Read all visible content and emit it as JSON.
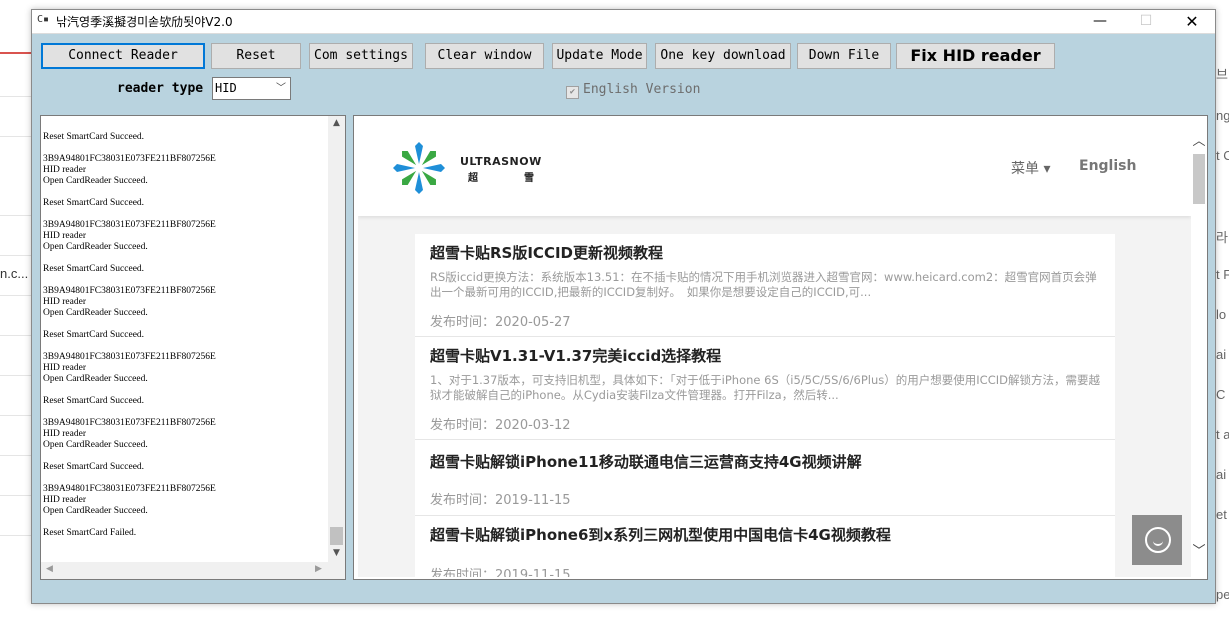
{
  "window": {
    "title": "낚汽영季溪擬경미솓欤劤됫야V2.0",
    "icon_text": "C▪",
    "controls": {
      "minimize": "—",
      "maximize": "☐",
      "close": "✕"
    }
  },
  "toolbar": {
    "connect": "Connect Reader",
    "reset": "Reset",
    "com_settings": "Com settings",
    "clear_window": "Clear window",
    "update_mode": "Update Mode",
    "one_key_download": "One key download",
    "down_file": "Down File",
    "fix_hid": "Fix HID reader"
  },
  "reader_type": {
    "label": "reader type",
    "value": "HID"
  },
  "english_version": {
    "label": "English Version",
    "checked": true
  },
  "log_lines": [
    "Reset SmartCard Succeed.",
    "",
    "3B9A94801FC38031E073FE211BF807256E",
    "HID reader",
    "Open CardReader Succeed.",
    "",
    "Reset SmartCard Succeed.",
    "",
    "3B9A94801FC38031E073FE211BF807256E",
    "HID reader",
    "Open CardReader Succeed.",
    "",
    "Reset SmartCard Succeed.",
    "",
    "3B9A94801FC38031E073FE211BF807256E",
    "HID reader",
    "Open CardReader Succeed.",
    "",
    "Reset SmartCard Succeed.",
    "",
    "3B9A94801FC38031E073FE211BF807256E",
    "HID reader",
    "Open CardReader Succeed.",
    "",
    "Reset SmartCard Succeed.",
    "",
    "3B9A94801FC38031E073FE211BF807256E",
    "HID reader",
    "Open CardReader Succeed.",
    "",
    "Reset SmartCard Succeed.",
    "",
    "3B9A94801FC38031E073FE211BF807256E",
    "HID reader",
    "Open CardReader Succeed.",
    "",
    "Reset SmartCard Failed."
  ],
  "web": {
    "logo_text": "ULTRASNOW",
    "logo_cn": "超雪",
    "menu": "菜单 ▾",
    "lang": "English",
    "articles": [
      {
        "title": "超雪卡贴RS版ICCID更新视频教程",
        "summary": "RS版iccid更换方法：系统版本13.51：在不插卡贴的情况下用手机浏览器进入超雪官网：www.heicard.com2：超雪官网首页会弹出一个最新可用的ICCID,把最新的ICCID复制好。　如果你是想要设定自己的ICCID,可...",
        "date": "发布时间：2020-05-27"
      },
      {
        "title": "超雪卡贴V1.31-V1.37完美iccid选择教程",
        "summary": "1、对于1.37版本，可支持旧机型，具体如下：「对于低于iPhone 6S（i5/5C/5S/6/6Plus）的用户想要使用ICCID解锁方法，需要越狱才能破解自己的iPhone。从Cydia安装Filza文件管理器。打开Filza，然后转...",
        "date": "发布时间：2020-03-12"
      },
      {
        "title": "超雪卡贴解锁iPhone11移动联通电信三运营商支持4G视频讲解",
        "summary": "",
        "date": "发布时间：2019-11-15"
      },
      {
        "title": "超雪卡贴解锁iPhone6到x系列三网机型使用中国电信卡4G视频教程",
        "summary": "",
        "date": "发布时间：2019-11-15"
      }
    ]
  },
  "background": {
    "left_text": "n.c...",
    "right_items": [
      "브",
      "ng",
      "t C",
      "라",
      "t F",
      "lo",
      "ai",
      "C",
      "t a",
      "ai",
      "et",
      "pe"
    ]
  },
  "colors": {
    "window_bg": "#b9d3df",
    "button_bg": "#e1e1e1",
    "focus_border": "#0078d7",
    "logo_blue": "#1f8fd8",
    "logo_green": "#3aa843"
  }
}
